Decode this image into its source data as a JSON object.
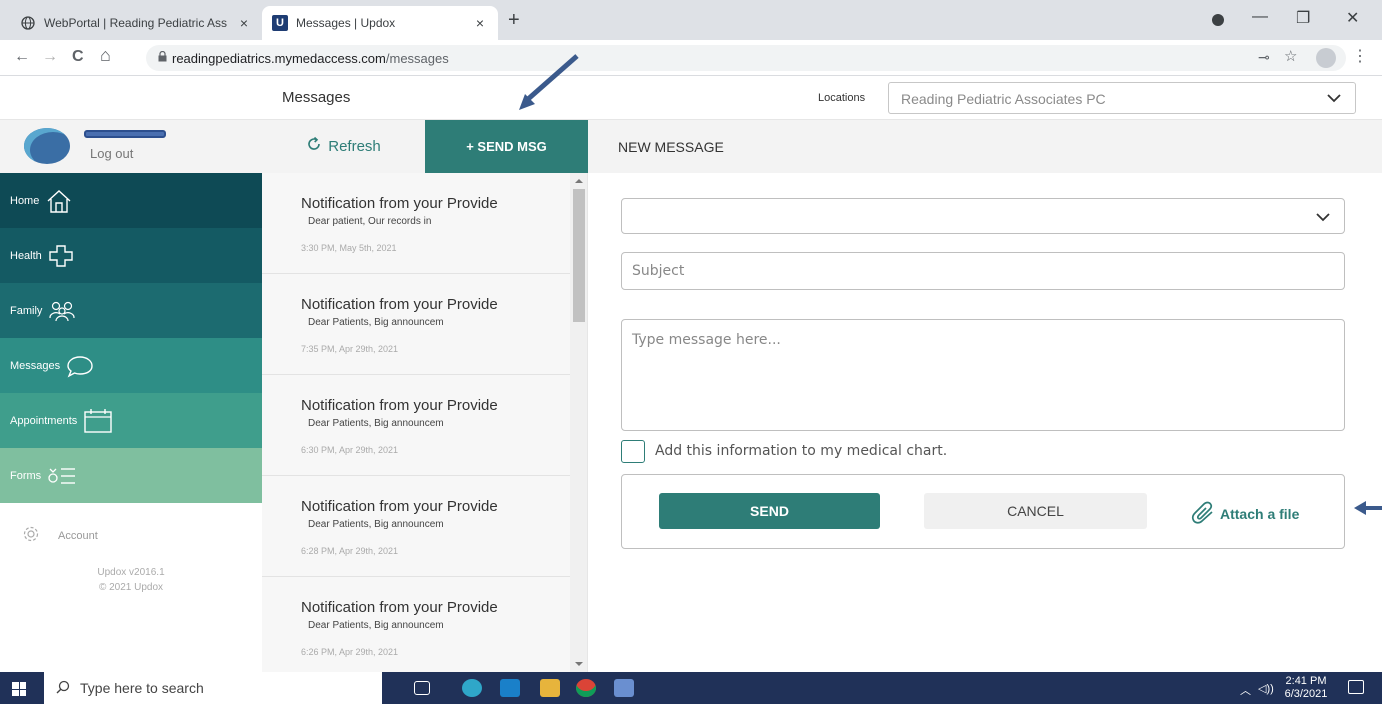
{
  "browser": {
    "tabs": [
      {
        "title": "WebPortal | Reading Pediatric Ass",
        "close": "×",
        "active": false
      },
      {
        "title": "Messages | Updox",
        "close": "×",
        "active": true,
        "favicon_letter": "U"
      }
    ],
    "new_tab": "+",
    "window_controls": {
      "minimize": "—",
      "restore": "❐",
      "close": "✕"
    },
    "nav": {
      "back": "←",
      "forward": "→",
      "reload": "C",
      "home": "⌂"
    },
    "url_host": "readingpediatrics.mymedaccess.com",
    "url_path": "/messages",
    "toolbar_icons": {
      "key": "⊸",
      "star": "☆",
      "menu": "⋮"
    }
  },
  "header": {
    "page_title": "Messages",
    "locations_label": "Locations",
    "location_value": "Reading Pediatric Associates PC"
  },
  "sidebar": {
    "logout": "Log out",
    "items": [
      {
        "label": "Home",
        "icon": "home-icon",
        "color": "#0e4a55"
      },
      {
        "label": "Health",
        "icon": "health-cross-icon",
        "color": "#145a63"
      },
      {
        "label": "Family",
        "icon": "family-icon",
        "color": "#1c6b70"
      },
      {
        "label": "Messages",
        "icon": "chat-bubble-icon",
        "color": "#2e8e86",
        "active": true
      },
      {
        "label": "Appointments",
        "icon": "calendar-icon",
        "color": "#3f9e8c"
      },
      {
        "label": "Forms",
        "icon": "forms-icon",
        "color": "#7fbf9f"
      }
    ],
    "account": "Account",
    "version": "Updox v2016.1",
    "copyright": "© 2021 Updox"
  },
  "list_toolbar": {
    "refresh": "Refresh",
    "send_msg": "+ SEND MSG"
  },
  "messages": [
    {
      "subject": "Notification from your Provide",
      "preview": "Dear patient, Our records in",
      "time": "3:30 PM, May 5th, 2021"
    },
    {
      "subject": "Notification from your Provide",
      "preview": "Dear Patients, Big announcem",
      "time": "7:35 PM, Apr 29th, 2021"
    },
    {
      "subject": "Notification from your Provide",
      "preview": "Dear Patients, Big announcem",
      "time": "6:30 PM, Apr 29th, 2021"
    },
    {
      "subject": "Notification from your Provide",
      "preview": "Dear Patients, Big announcem",
      "time": "6:28 PM, Apr 29th, 2021"
    },
    {
      "subject": "Notification from your Provide",
      "preview": "Dear Patients, Big announcem",
      "time": "6:26 PM, Apr 29th, 2021"
    }
  ],
  "compose": {
    "title": "NEW MESSAGE",
    "recipient_value": "",
    "subject_placeholder": "Subject",
    "message_placeholder": "Type message here...",
    "chart_checkbox_label": "Add this information to my medical chart.",
    "chart_checked": false,
    "send": "SEND",
    "cancel": "CANCEL",
    "attach": "Attach a file"
  },
  "taskbar": {
    "search_placeholder": "Type here to search",
    "time": "2:41 PM",
    "date": "6/3/2021"
  },
  "colors": {
    "accent": "#2e7d77",
    "annotation_arrow": "#3b5a8c"
  }
}
